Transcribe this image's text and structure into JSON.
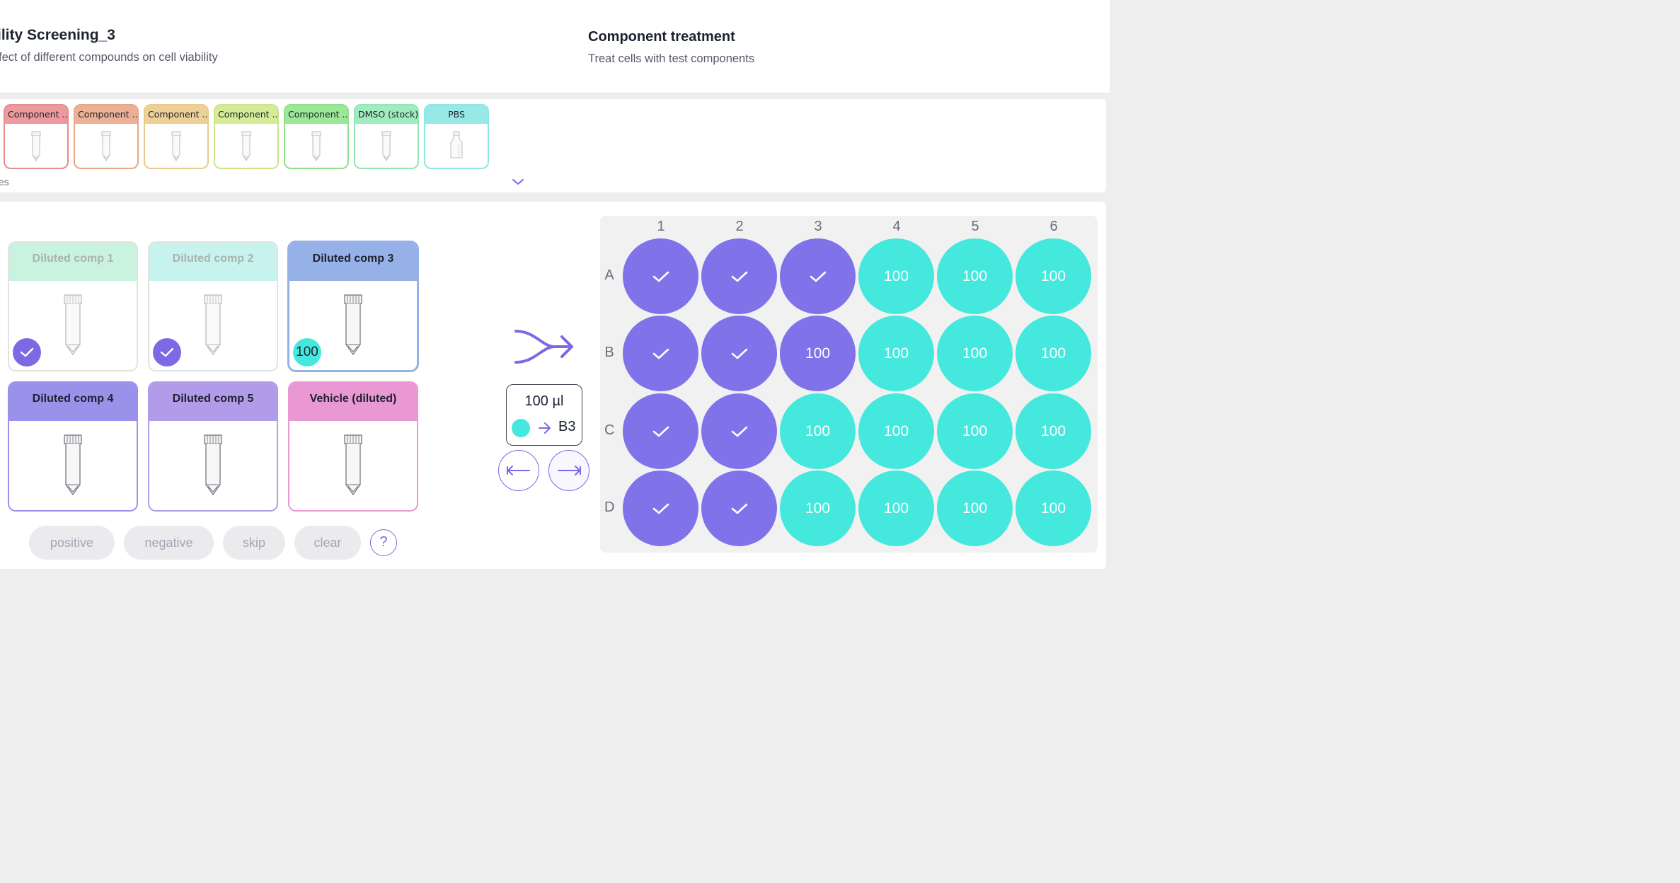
{
  "header": {
    "experiment_title": "ility Screening_3",
    "experiment_subtitle": "fect of different compounds on cell viability",
    "step_title": "Component treatment",
    "step_subtitle": "Treat cells with test components"
  },
  "stocks": {
    "items": [
      {
        "label": "Component ...",
        "border": "#e98a8e",
        "header_bg": "#ec9a9d",
        "icon": "tube-icon"
      },
      {
        "label": "Component ...",
        "border": "#e8a788",
        "header_bg": "#ebb095",
        "icon": "tube-icon"
      },
      {
        "label": "Component ...",
        "border": "#e9c98c",
        "header_bg": "#ecd098",
        "icon": "tube-icon"
      },
      {
        "label": "Component ...",
        "border": "#cde38c",
        "header_bg": "#d6eb97",
        "icon": "tube-icon"
      },
      {
        "label": "Component ...",
        "border": "#8fe08c",
        "header_bg": "#9ce899",
        "icon": "tube-icon"
      },
      {
        "label": "DMSO (stock)",
        "border": "#93e6b3",
        "header_bg": "#a1ecbf",
        "icon": "tube-icon"
      },
      {
        "label": "PBS",
        "border": "#8ee7e3",
        "header_bg": "#98e9e6",
        "icon": "bottle-icon"
      }
    ],
    "footer_text": "es"
  },
  "dilutions": [
    {
      "label": "Diluted comp 1",
      "color": "#c9f2df",
      "border": "#dfe4e2",
      "state": "done",
      "faded": true
    },
    {
      "label": "Diluted comp 2",
      "color": "#c8f2ee",
      "border": "#dfe4e2",
      "state": "done",
      "faded": true
    },
    {
      "label": "Diluted comp 3",
      "color": "#96b1e8",
      "border": "#96b1e8",
      "state": "active",
      "amount": "100",
      "faded": false
    },
    {
      "label": "Diluted comp 4",
      "color": "#9a92ea",
      "border": "#9a92ea",
      "state": "none",
      "faded": false
    },
    {
      "label": "Diluted comp 5",
      "color": "#b29be9",
      "border": "#b29be9",
      "state": "none",
      "faded": false
    },
    {
      "label": "Vehicle (diluted)",
      "color": "#ea98d3",
      "border": "#ea98d3",
      "state": "none",
      "faded": false
    }
  ],
  "actions": {
    "positive": "positive",
    "negative": "negative",
    "skip": "skip",
    "clear": "clear",
    "help": "?"
  },
  "transfer": {
    "volume": "100 µl",
    "target_well": "B3",
    "source_color": "#45e8dd"
  },
  "plate": {
    "columns": [
      "1",
      "2",
      "3",
      "4",
      "5",
      "6"
    ],
    "rows": [
      "A",
      "B",
      "C",
      "D"
    ],
    "colors": {
      "done": "#8073ea",
      "todo": "#45e8dd"
    },
    "wells": [
      [
        "done",
        "done",
        "done",
        "100",
        "100",
        "100"
      ],
      [
        "done",
        "done",
        "100*",
        "100",
        "100",
        "100"
      ],
      [
        "done",
        "done",
        "100",
        "100",
        "100",
        "100"
      ],
      [
        "done",
        "done",
        "100",
        "100",
        "100",
        "100"
      ]
    ]
  }
}
